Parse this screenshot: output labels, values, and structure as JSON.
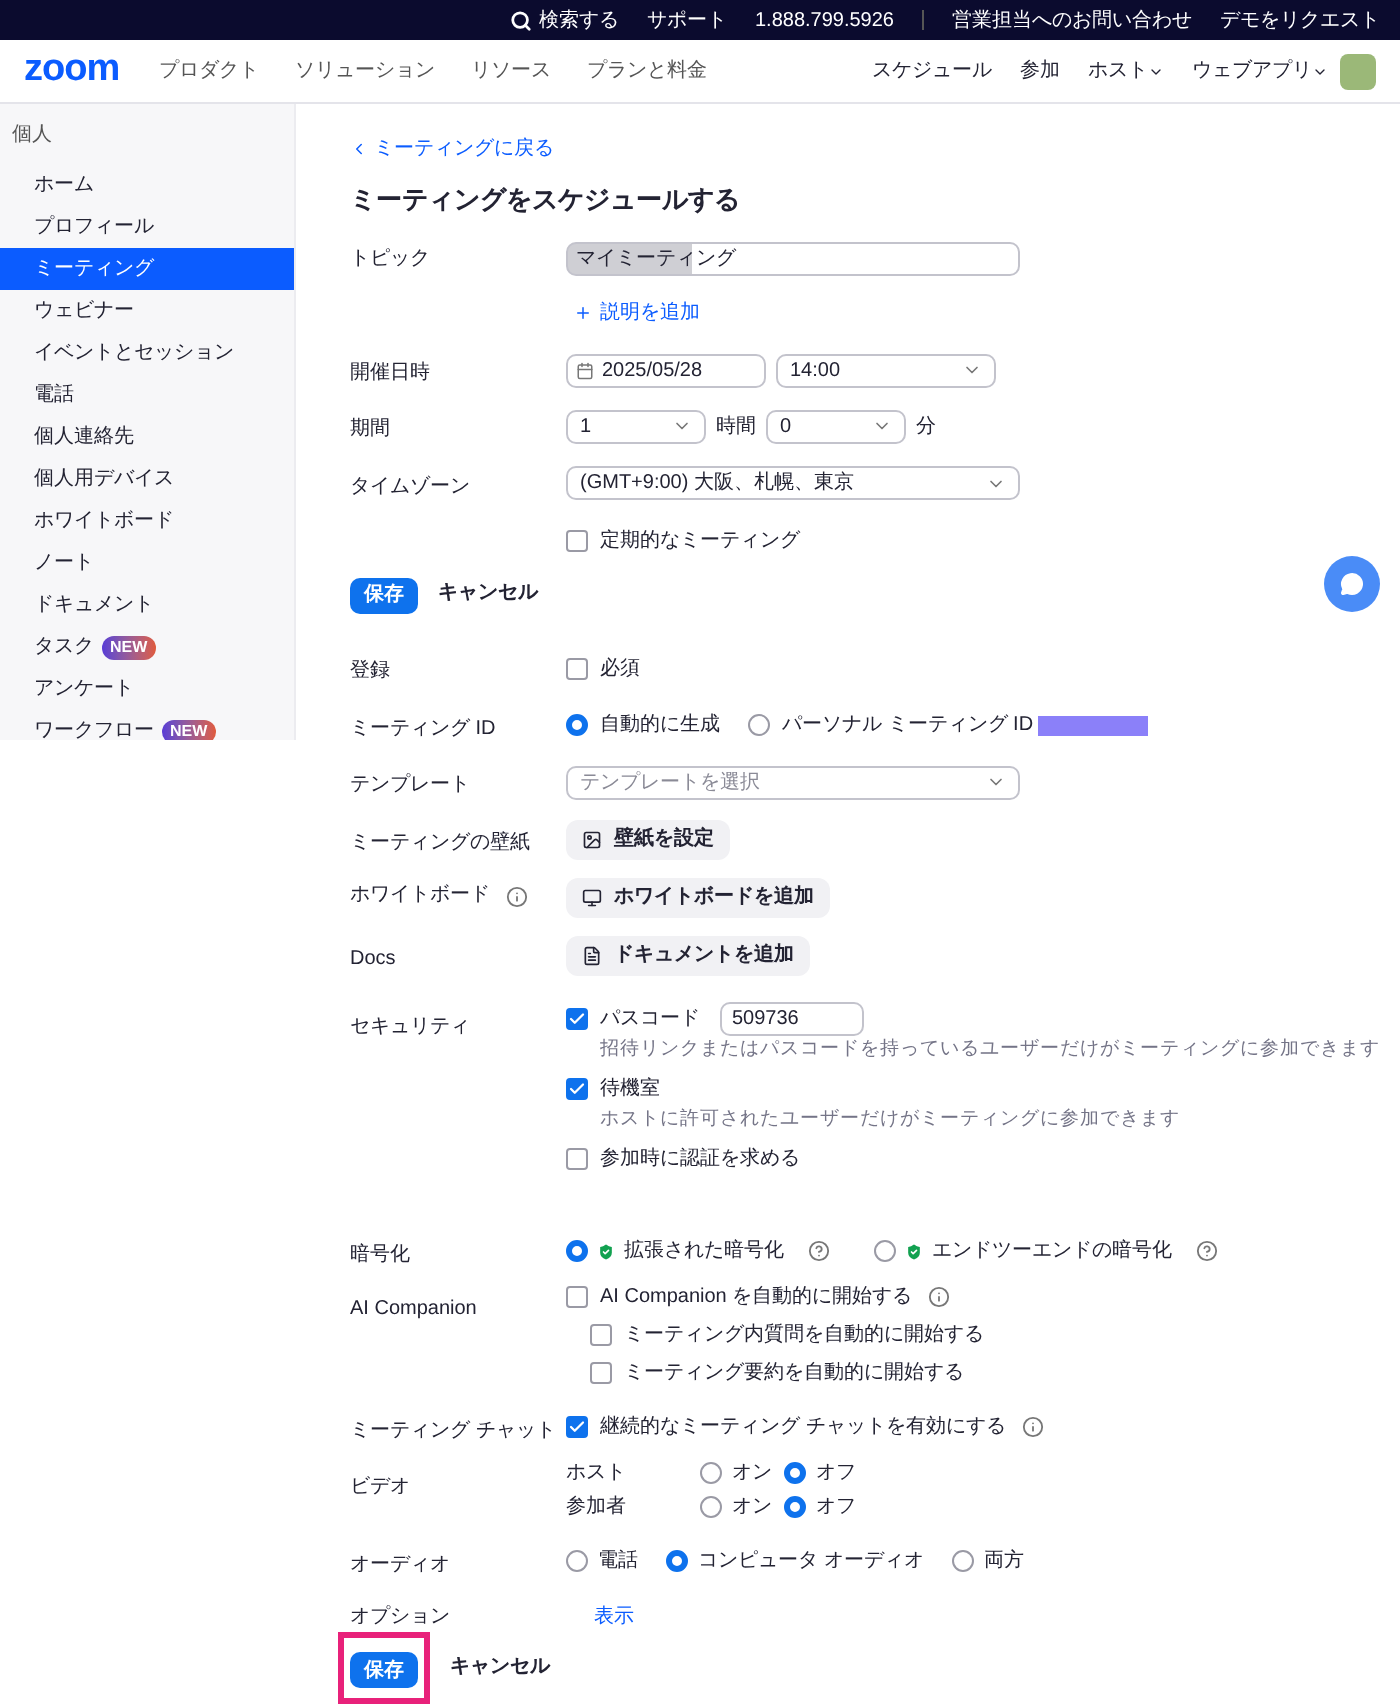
{
  "top_bar": {
    "search": "検索する",
    "links": [
      "サポート",
      "1.888.799.5926",
      "営業担当へのお問い合わせ",
      "デモをリクエスト"
    ]
  },
  "nav": {
    "logo": "zoom",
    "menu": [
      "プロダクト",
      "ソリューション",
      "リソース",
      "プランと料金"
    ],
    "right": [
      {
        "label": "スケジュール",
        "dropdown": false
      },
      {
        "label": "参加",
        "dropdown": false
      },
      {
        "label": "ホスト",
        "dropdown": true
      },
      {
        "label": "ウェブアプリ",
        "dropdown": true
      }
    ]
  },
  "sidebar": {
    "section": "個人",
    "items": [
      {
        "label": "ホーム",
        "selected": false
      },
      {
        "label": "プロフィール",
        "selected": false
      },
      {
        "label": "ミーティング",
        "selected": true
      },
      {
        "label": "ウェビナー",
        "selected": false
      },
      {
        "label": "イベントとセッション",
        "selected": false
      },
      {
        "label": "電話",
        "selected": false
      },
      {
        "label": "個人連絡先",
        "selected": false
      },
      {
        "label": "個人用デバイス",
        "selected": false
      },
      {
        "label": "ホワイトボード",
        "selected": false
      },
      {
        "label": "ノート",
        "selected": false
      },
      {
        "label": "ドキュメント",
        "selected": false
      },
      {
        "label": "タスク",
        "selected": false,
        "badge": "NEW"
      },
      {
        "label": "アンケート",
        "selected": false
      },
      {
        "label": "ワークフロー",
        "selected": false,
        "badge": "NEW"
      }
    ]
  },
  "back_link": "ミーティングに戻る",
  "title": "ミーティングをスケジュールする",
  "topic": {
    "label": "トピック",
    "value": "マイミーティング"
  },
  "add_description": "説明を追加",
  "when": {
    "label": "開催日時",
    "date": "2025/05/28",
    "time": "14:00"
  },
  "duration": {
    "label": "期間",
    "hours": "1",
    "hours_unit": "時間",
    "minutes": "0",
    "minutes_unit": "分"
  },
  "timezone": {
    "label": "タイムゾーン",
    "value": "(GMT+9:00) 大阪、札幌、東京"
  },
  "recurring": {
    "label": "定期的なミーティング",
    "checked": false
  },
  "top_actions": {
    "save": "保存",
    "cancel": "キャンセル",
    "highlighted": false
  },
  "registration": {
    "label": "登録",
    "option": {
      "label": "必須",
      "checked": false
    }
  },
  "meeting_id": {
    "label": "ミーティング ID",
    "options": [
      {
        "label": "自動的に生成",
        "selected": true,
        "redacted": false
      },
      {
        "label": "パーソナル ミーティング ID",
        "selected": false,
        "redacted": true
      }
    ]
  },
  "template": {
    "label": "テンプレート",
    "placeholder": "テンプレートを選択"
  },
  "wallpaper": {
    "label": "ミーティングの壁紙",
    "button": "壁紙を設定"
  },
  "whiteboard": {
    "label": "ホワイトボード",
    "button": "ホワイトボードを追加"
  },
  "docs": {
    "label": "Docs",
    "button": "ドキュメントを追加"
  },
  "security": {
    "label": "セキュリティ",
    "items": [
      {
        "label": "パスコード",
        "checked": true,
        "value": "509736",
        "hint": "招待リンクまたはパスコードを持っているユーザーだけがミーティングに参加できます"
      },
      {
        "label": "待機室",
        "checked": true,
        "hint": "ホストに許可されたユーザーだけがミーティングに参加できます"
      },
      {
        "label": "参加時に認証を求める",
        "checked": false
      }
    ]
  },
  "encryption": {
    "label": "暗号化",
    "options": [
      {
        "label": "拡張された暗号化",
        "selected": true
      },
      {
        "label": "エンドツーエンドの暗号化",
        "selected": false
      }
    ]
  },
  "ai_companion": {
    "label": "AI Companion",
    "main": {
      "label": "AI Companion を自動的に開始する",
      "checked": false
    },
    "children": [
      {
        "label": "ミーティング内質問を自動的に開始する",
        "checked": false
      },
      {
        "label": "ミーティング要約を自動的に開始する",
        "checked": false
      }
    ]
  },
  "chat": {
    "label": "ミーティング チャット",
    "option": {
      "label": "継続的なミーティング チャットを有効にする",
      "checked": true
    }
  },
  "video": {
    "label": "ビデオ",
    "rows": [
      {
        "label": "ホスト",
        "options": [
          {
            "label": "オン",
            "selected": false
          },
          {
            "label": "オフ",
            "selected": true
          }
        ]
      },
      {
        "label": "参加者",
        "options": [
          {
            "label": "オン",
            "selected": false
          },
          {
            "label": "オフ",
            "selected": true
          }
        ]
      }
    ]
  },
  "audio": {
    "label": "オーディオ",
    "options": [
      {
        "label": "電話",
        "selected": false
      },
      {
        "label": "コンピュータ オーディオ",
        "selected": true
      },
      {
        "label": "両方",
        "selected": false
      }
    ]
  },
  "options": {
    "label": "オプション",
    "link": "表示"
  },
  "bottom_actions": {
    "save": "保存",
    "cancel": "キャンセル",
    "highlighted": true
  }
}
